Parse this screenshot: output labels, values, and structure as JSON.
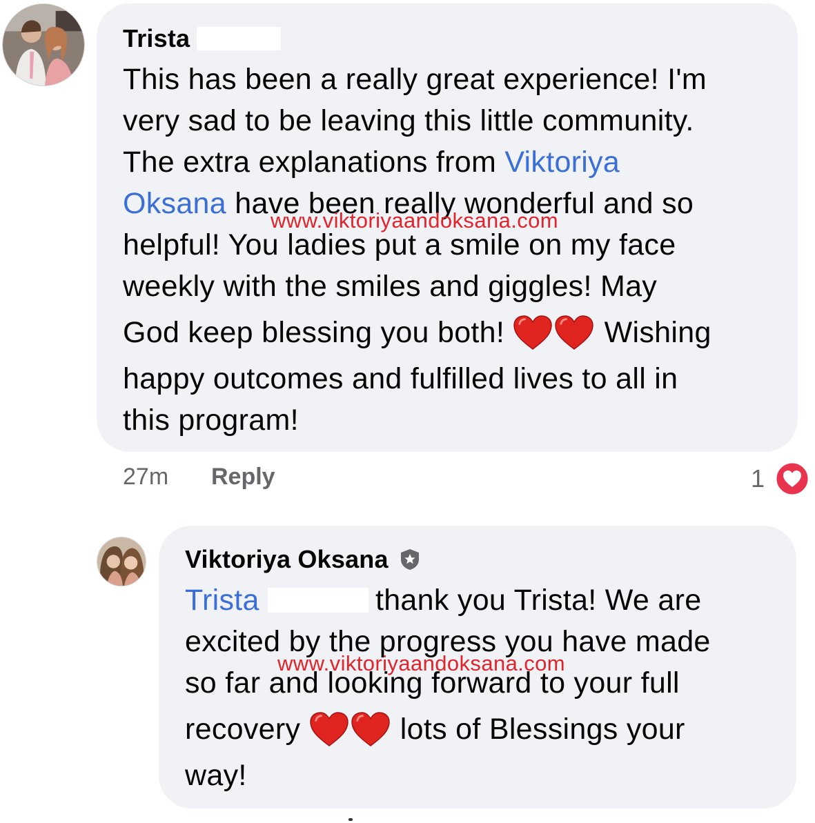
{
  "comment": {
    "author": "Trista",
    "lines": [
      "This has been a really great experience! I'm",
      "very sad to be leaving this little community.",
      "The extra explanations from "
    ],
    "mention_first": "Viktoriya",
    "mention_second": "Oksana",
    "line4_rest": " have been really wonderful and so",
    "line5": "helpful! You ladies put a smile on my face",
    "line6": "weekly with the smiles and giggles! May",
    "line7_start": "God keep blessing you both! ",
    "line7_end": " Wishing",
    "line8": "happy outcomes and fulfilled lives to all in",
    "line9": "this program!",
    "time": "27m",
    "reply_label": "Reply",
    "reaction_count": "1",
    "reaction_icon": "heart-reaction-icon"
  },
  "reply": {
    "author": "Viktoriya Oksana",
    "badge_icon": "shield-badge-icon",
    "mention": "Trista",
    "line1_rest": "thank you Trista! We are",
    "line2": "excited by the progress you have made",
    "line3": "so far and looking forward to your full",
    "line4_start": "recovery ",
    "line4_end": " lots of Blessings your",
    "line5": "way!"
  },
  "watermark": "www.viktoriyaandoksana.com",
  "colors": {
    "bubble": "#f0f2f5",
    "mention": "#3b6fd6",
    "watermark": "#e0242b",
    "meta": "#65676b",
    "heart": "#e41e3f"
  }
}
